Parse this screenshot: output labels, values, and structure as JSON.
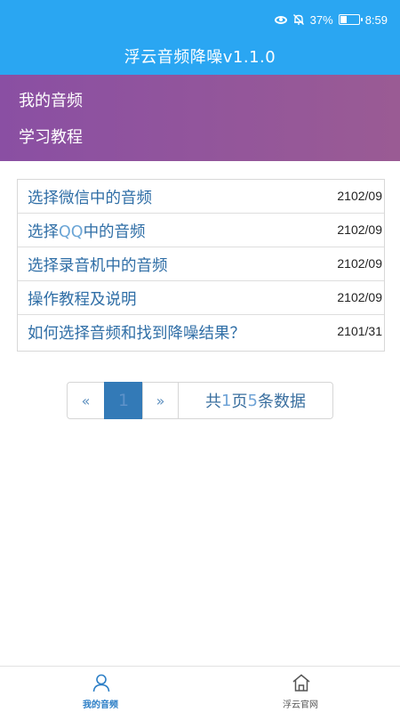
{
  "status_bar": {
    "battery_percent": "37%",
    "battery_level": 0.37,
    "time": "8:59",
    "icons": [
      "eye-icon",
      "mute-bell-icon",
      "battery-icon"
    ]
  },
  "header": {
    "title": "浮云音频降噪v1.1.0"
  },
  "menu": {
    "items": [
      {
        "label": "我的音频"
      },
      {
        "label": "学习教程"
      }
    ]
  },
  "list": {
    "rows": [
      {
        "title": "选择微信中的音频",
        "date": "2102/09"
      },
      {
        "title_pre": "选择",
        "title_q": "QQ",
        "title_post": "中的音频",
        "date": "2102/09"
      },
      {
        "title": "选择录音机中的音频",
        "date": "2102/09"
      },
      {
        "title": "操作教程及说明",
        "date": "2102/09"
      },
      {
        "title": "如何选择音频和找到降噪结果？",
        "date": "2101/31"
      }
    ]
  },
  "pagination": {
    "prev": "«",
    "current": "1",
    "next": "»",
    "info_pre": "共",
    "pages": "1",
    "info_mid": "页 ",
    "count": "5",
    "info_post": "条数据"
  },
  "tabbar": {
    "tabs": [
      {
        "label": "我的音频",
        "icon": "user-icon",
        "active": true
      },
      {
        "label": "浮云官网",
        "icon": "home-icon",
        "active": false
      }
    ]
  },
  "colors": {
    "header_bg": "#2aa6f2",
    "menu_gradient_start": "#8a4fa3",
    "menu_gradient_end": "#9a5b94",
    "link_text": "#2f6ea6",
    "active_page_bg": "#337ab7",
    "active_tab": "#2b7ec6"
  }
}
